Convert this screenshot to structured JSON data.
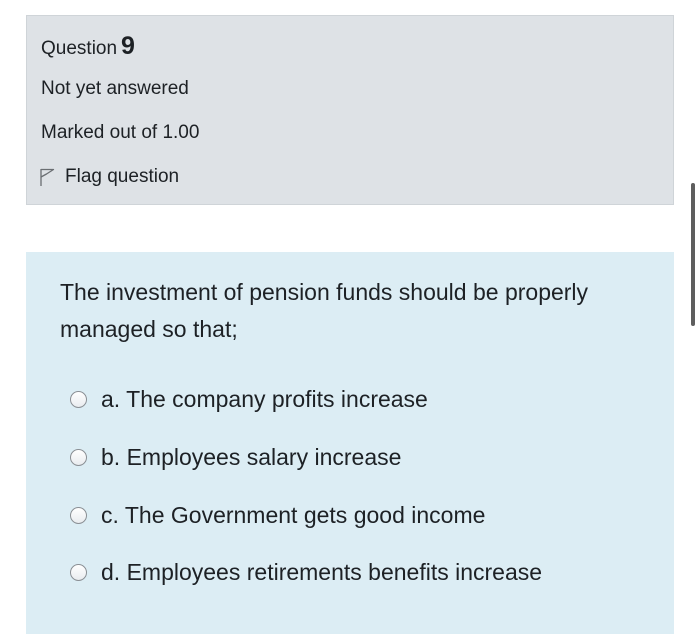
{
  "question": {
    "label": "Question",
    "number": "9",
    "state": "Not yet answered",
    "grade": "Marked out of 1.00",
    "flag_label": "Flag question"
  },
  "content": {
    "text": "The investment of pension funds should be properly managed so that;",
    "answers": [
      {
        "text": "a. The company profits increase"
      },
      {
        "text": "b. Employees salary increase"
      },
      {
        "text": "c. The Government gets good income"
      },
      {
        "text": "d. Employees retirements benefits increase"
      }
    ]
  },
  "colors": {
    "info_background": "#dee2e6",
    "content_background": "#dcedf4",
    "text": "#1d2125"
  },
  "icons": {
    "flag": "flag-icon",
    "radio": "radio-unchecked-icon"
  }
}
